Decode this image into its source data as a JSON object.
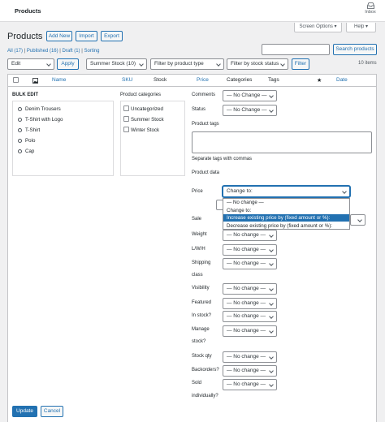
{
  "header": {
    "title": "Products",
    "inbox_label": "Inbox"
  },
  "screen_options": {
    "screen_options_label": "Screen Options",
    "help_label": "Help"
  },
  "page": {
    "title": "Products",
    "add_new": "Add New",
    "import": "Import",
    "export": "Export",
    "search_button": "Search products",
    "search_placeholder": ""
  },
  "subsubsub": [
    {
      "label": "All",
      "count": "(17)"
    },
    {
      "label": "Published",
      "count": "(16)"
    },
    {
      "label": "Draft",
      "count": "(1)"
    },
    {
      "label": "Sorting",
      "count": ""
    }
  ],
  "filters": {
    "bulk_action": "Edit",
    "apply": "Apply",
    "category": "Summer Stock  (10)",
    "product_type": "Filter by product type",
    "stock_status": "Filter by stock status",
    "filter": "Filter",
    "items_count": "10 items"
  },
  "columns": {
    "name": "Name",
    "sku": "SKU",
    "stock": "Stock",
    "price": "Price",
    "categories": "Categories",
    "tags": "Tags",
    "date": "Date"
  },
  "bulk_edit": {
    "title": "BULK EDIT",
    "products": [
      "Denim Trousers",
      "T-Shirt with Logo",
      "T-Shirt",
      "Polo",
      "Cap"
    ],
    "categories_label": "Product categories",
    "categories": [
      "Uncategorized",
      "Summer Stock",
      "Winter Stock"
    ],
    "comments_label": "Comments",
    "comments_value": "— No Change —",
    "status_label": "Status",
    "status_value": "— No Change —",
    "tags_label": "Product tags",
    "tags_hint": "Separate tags with commas",
    "product_data_label": "Product data",
    "price_label": "Price",
    "price_value": "Change to:",
    "price_options": [
      "— No change —",
      "Change to:",
      "Increase existing price by (fixed amount or %):",
      "Decrease existing price by (fixed amount or %):"
    ],
    "price_selected_index": 2,
    "sale_label": "Sale",
    "weight_label": "Weight",
    "weight_value": "— No change —",
    "lwh_label": "L/W/H",
    "lwh_value": "— No change —",
    "shipping_label": "Shipping",
    "shipping_label2": "class",
    "shipping_value": "— No change —",
    "visibility_label": "Visibility",
    "visibility_value": "— No change —",
    "featured_label": "Featured",
    "featured_value": "— No change —",
    "instock_label": "In stock?",
    "instock_value": "— No change —",
    "manage_label": "Manage",
    "manage_label2": "stock?",
    "manage_value": "— No change —",
    "stockqty_label": "Stock qty",
    "stockqty_value": "— No change —",
    "backorders_label": "Backorders?",
    "backorders_value": "— No change —",
    "sold_label": "Sold",
    "sold_label2": "individually?",
    "sold_value": "— No change —",
    "update": "Update",
    "cancel": "Cancel"
  }
}
